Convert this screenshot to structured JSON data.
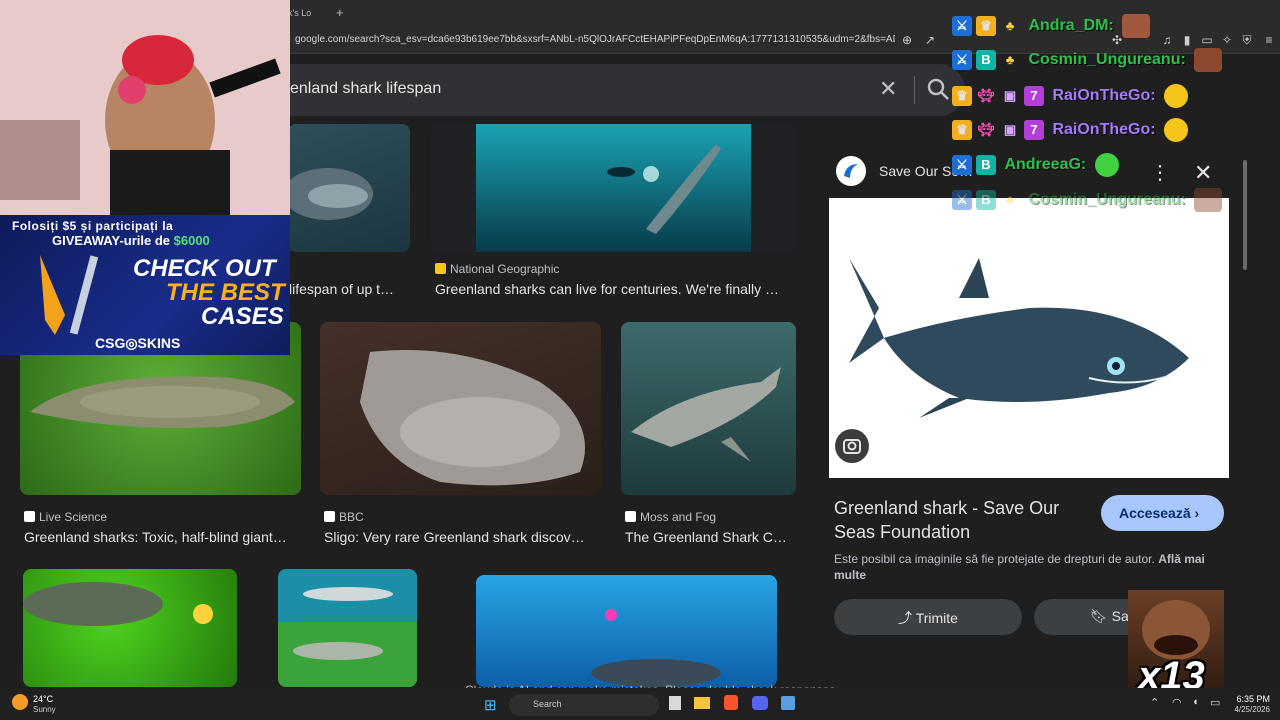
{
  "browser": {
    "tab_title": "ark's Lo",
    "new_tab": "+",
    "url": "google.com/search?sca_esv=dca6e93b619ee7bb&sxsrf=ANbL-n5QlOJrAFCctEHAPiPFeqDpEnM6qA:1777131310535&udm=2&fbs=ADc_I-Zh6v..."
  },
  "search": {
    "query": "enland shark lifespan"
  },
  "results": [
    {
      "source": "",
      "title": "lifespan of up t…",
      "fav_color": "#888888"
    },
    {
      "source": "National Geographic",
      "title": "Greenland sharks can live for centuries. We're finally …",
      "fav_color": "#f5c518"
    },
    {
      "source": "Live Science",
      "title": "Greenland sharks: Toxic, half-blind giant…",
      "fav_color": "#ffffff"
    },
    {
      "source": "BBC",
      "title": "Sligo: Very rare Greenland shark discov…",
      "fav_color": "#ffffff"
    },
    {
      "source": "Moss and Fog",
      "title": "The Greenland Shark C…",
      "fav_color": "#ffffff"
    }
  ],
  "promo": {
    "line1": "Folosiți $5 și participați la",
    "line2_prefix": "GIVEAWAY-urile de ",
    "line2_amount": "$6000",
    "cta1": "CHECK OUT",
    "cta2": "THE BEST",
    "cta3": "CASES",
    "brand": "CSG◎SKINS"
  },
  "panel": {
    "site": "Save Our Se…",
    "title": "Greenland shark - Save Our Seas Foundation",
    "visit_label": "Accesează",
    "copyright": "Este posibil ca imaginile să fie protejate de drepturi de autor.",
    "learn_more": "Află mai multe",
    "share_label": "Trimite",
    "save_label": "Sal"
  },
  "chat": [
    {
      "name": "Andra_DM:",
      "color": "green"
    },
    {
      "name": "Cosmin_Ungureanu:",
      "color": "green"
    },
    {
      "name": "RaiOnTheGo:",
      "color": "purple"
    },
    {
      "name": "RaiOnTheGo:",
      "color": "purple"
    },
    {
      "name": "AndreeaG:",
      "color": "green"
    },
    {
      "name": "Cosmin_Ungureanu:",
      "color": "green"
    }
  ],
  "overlay": {
    "counter": "x13",
    "claude_note": "Claude is AI and can make mistakes. Please double-check responses."
  },
  "taskbar": {
    "temp": "24°C",
    "weather": "Sunny",
    "search": "Search",
    "time": "6:35 PM",
    "date": "4/25/2026"
  },
  "colors": {
    "accent": "#a8c7fa",
    "chat_green": "#2ec24a",
    "chat_purple": "#a67bff"
  }
}
